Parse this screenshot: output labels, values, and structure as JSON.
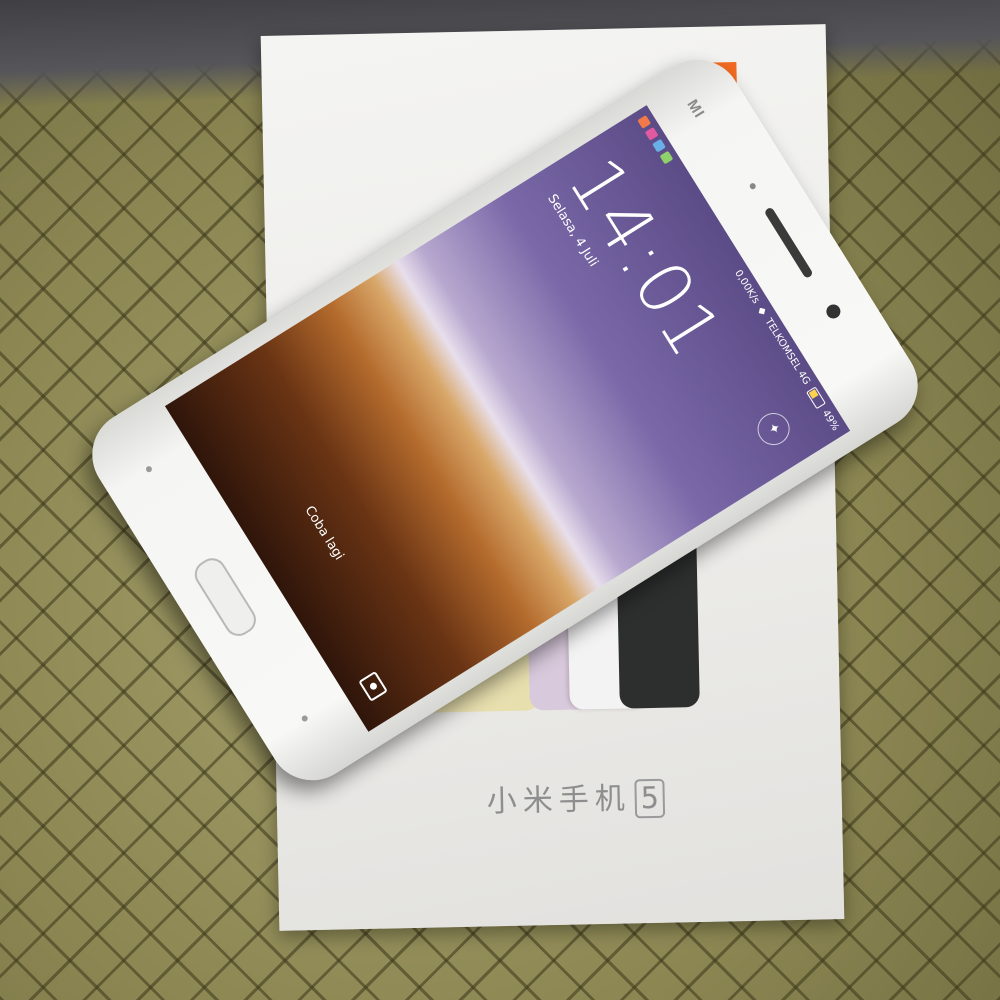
{
  "box": {
    "brand_logo": "MI",
    "title_text": "小米手机",
    "title_number": "5",
    "colors": {
      "box": "#f0efec",
      "logo": "#f26a21"
    }
  },
  "phone": {
    "brand": "MI",
    "status_bar": {
      "speed": "0,00K/s",
      "carrier": "TELKOMSEL 4G",
      "battery": "49%"
    },
    "lockscreen": {
      "time": "14:01",
      "date": "Selasa, 4 Juli",
      "hint": "Coba lagi"
    },
    "icons": [
      "flashlight-icon",
      "camera-icon",
      "battery-icon",
      "wifi-icon"
    ]
  }
}
